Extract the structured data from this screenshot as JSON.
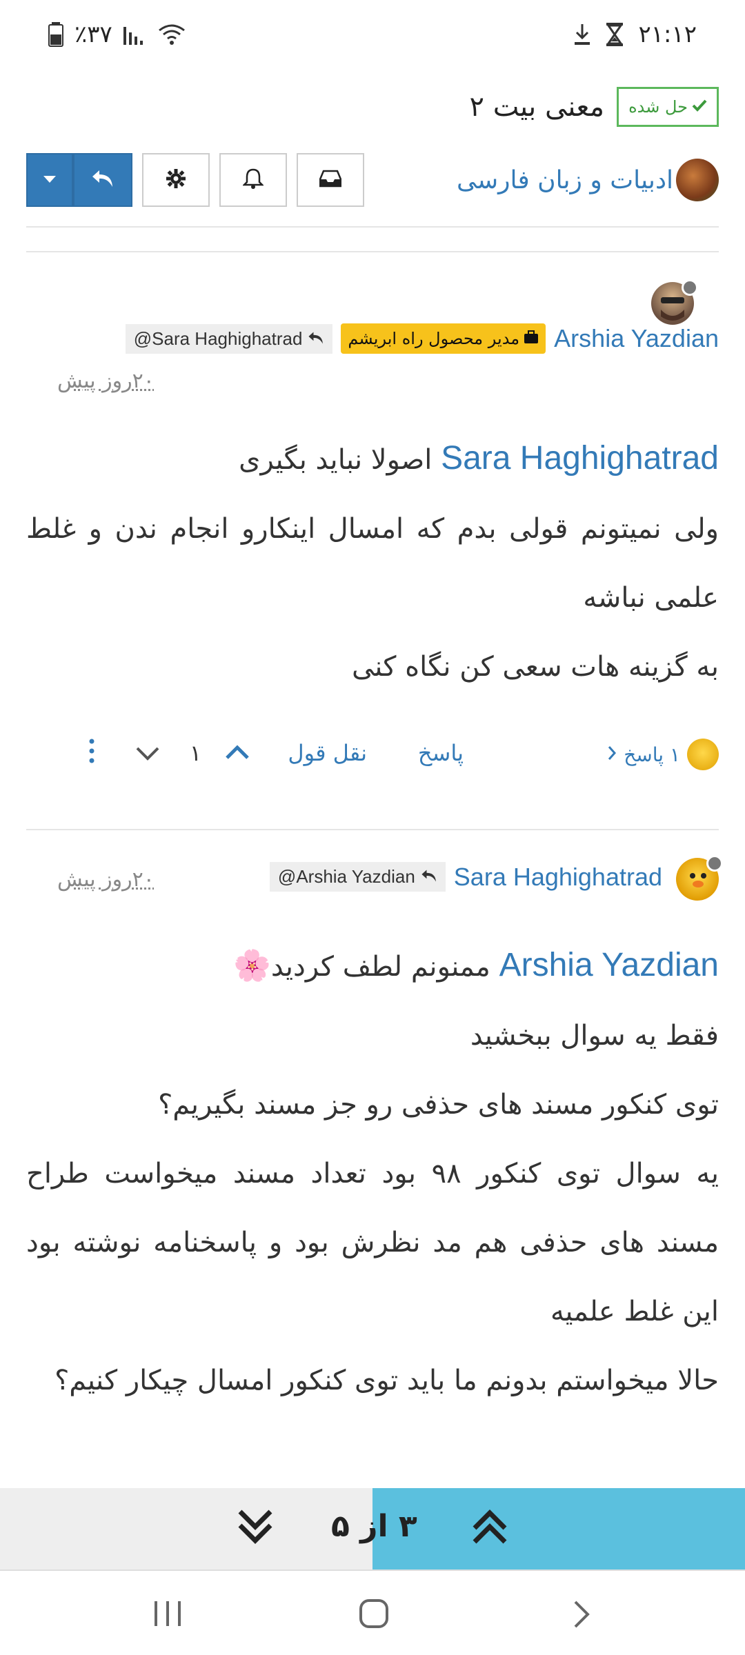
{
  "status_bar": {
    "time": "۲۱:۱۲",
    "battery": "٪۳۷"
  },
  "topic": {
    "title": "معنی بیت ۲",
    "solved_label": "حل شده",
    "category": "ادبیات و زبان فارسی"
  },
  "posts": [
    {
      "author": "Arshia Yazdian",
      "role_badge": "مدیر محصول راه ابریشم",
      "reply_to": "@Sara Haghighatrad",
      "time_ago": "۲۰روز پیش",
      "mention": "Sara Haghighatrad",
      "line1_rest": " اصولا نباید بگیری",
      "paragraphs": [
        "ولی نمیتونم قولی بدم که امسال اینکارو انجام ندن و غلط علمی نباشه",
        "به گزینه هات سعی کن نگاه کنی"
      ],
      "footer": {
        "replies_label": "۱ پاسخ",
        "reply_label": "پاسخ",
        "quote_label": "نقل قول",
        "votes": "۱"
      }
    },
    {
      "author": "Sara Haghighatrad",
      "reply_to": "@Arshia Yazdian",
      "time_ago": "۲۰روز پیش",
      "mention": "Arshia Yazdian",
      "line1_rest": " ممنونم لطف کردید",
      "emoji": "🌸",
      "paragraphs": [
        "فقط یه سوال ببخشید",
        "توی کنکور مسند های حذفی رو جز مسند بگیریم؟",
        "یه سوال توی کنکور ۹۸ بود تعداد مسند میخواست طراح مسند های حذفی هم مد نظرش بود و پاسخنامه نوشته بود این غلط علمیه",
        "حالا میخواستم بدونم ما باید توی کنکور امسال چیکار کنیم؟"
      ]
    }
  ],
  "pagination": {
    "label": "۳ از ۵",
    "progress": 0.5
  }
}
